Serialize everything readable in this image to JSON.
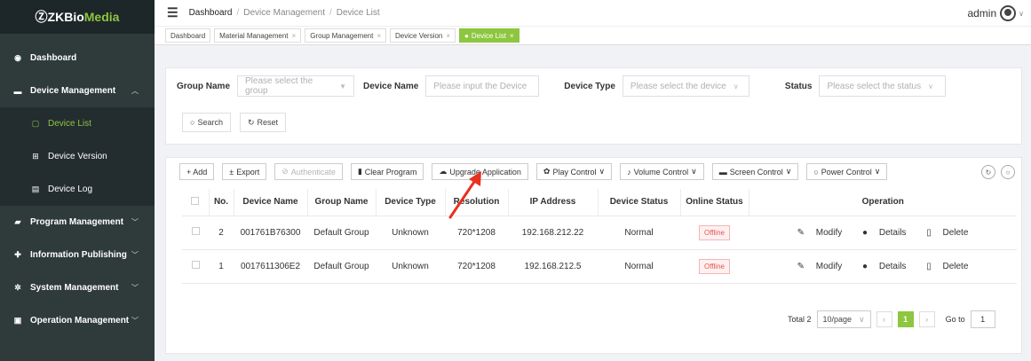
{
  "app": {
    "logo_prefix": "ⓏZKBio",
    "logo_suffix": "Media"
  },
  "sidebar": {
    "items": [
      {
        "label": "Dashboard",
        "icon": "dashboard-icon"
      },
      {
        "label": "Device Management",
        "icon": "device-icon"
      },
      {
        "label": "Device List",
        "icon": "list-icon"
      },
      {
        "label": "Device Version",
        "icon": "version-icon"
      },
      {
        "label": "Device Log",
        "icon": "log-icon"
      },
      {
        "label": "Program Management",
        "icon": "program-icon"
      },
      {
        "label": "Information Publishing",
        "icon": "publish-icon"
      },
      {
        "label": "System Management",
        "icon": "gear-icon"
      },
      {
        "label": "Operation Management",
        "icon": "monitor-icon"
      }
    ]
  },
  "header": {
    "breadcrumb": [
      "Dashboard",
      "Device Management",
      "Device List"
    ],
    "user": "admin"
  },
  "tabs": [
    "Dashboard",
    "Material Management",
    "Group Management",
    "Device Version",
    "Device List"
  ],
  "filters": {
    "group_label": "Group Name",
    "group_placeholder": "Please select the group",
    "device_label": "Device Name",
    "device_placeholder": "Please input the Device",
    "type_label": "Device Type",
    "type_placeholder": "Please select the device",
    "status_label": "Status",
    "status_placeholder": "Please select the status",
    "search": "Search",
    "reset": "Reset"
  },
  "toolbar": {
    "add": "+ Add",
    "export": "Export",
    "authenticate": "Authenticate",
    "clear": "Clear Program",
    "upgrade": "Upgrade Application",
    "play": "Play Control",
    "volume": "Volume Control",
    "screen": "Screen Control",
    "power": "Power Control"
  },
  "table": {
    "headers": [
      "No.",
      "Device Name",
      "Group Name",
      "Device Type",
      "Resolution",
      "IP Address",
      "Device Status",
      "Online Status",
      "Operation"
    ],
    "rows": [
      {
        "no": "2",
        "name": "001761B76300",
        "group": "Default Group",
        "type": "Unknown",
        "res": "720*1208",
        "ip": "192.168.212.22",
        "status": "Normal",
        "online": "Offline"
      },
      {
        "no": "1",
        "name": "0017611306E2",
        "group": "Default Group",
        "type": "Unknown",
        "res": "720*1208",
        "ip": "192.168.212.5",
        "status": "Normal",
        "online": "Offline"
      }
    ],
    "ops": {
      "modify": "Modify",
      "details": "Details",
      "delete": "Delete"
    }
  },
  "pagination": {
    "total": "Total 2",
    "per_page": "10/page",
    "page": "1",
    "goto_label": "Go to",
    "goto_value": "1"
  },
  "colors": {
    "accent": "#8dc63f",
    "sidebar": "#2f3a3b",
    "offline": "#e25555",
    "annotation": "#e8311f"
  }
}
